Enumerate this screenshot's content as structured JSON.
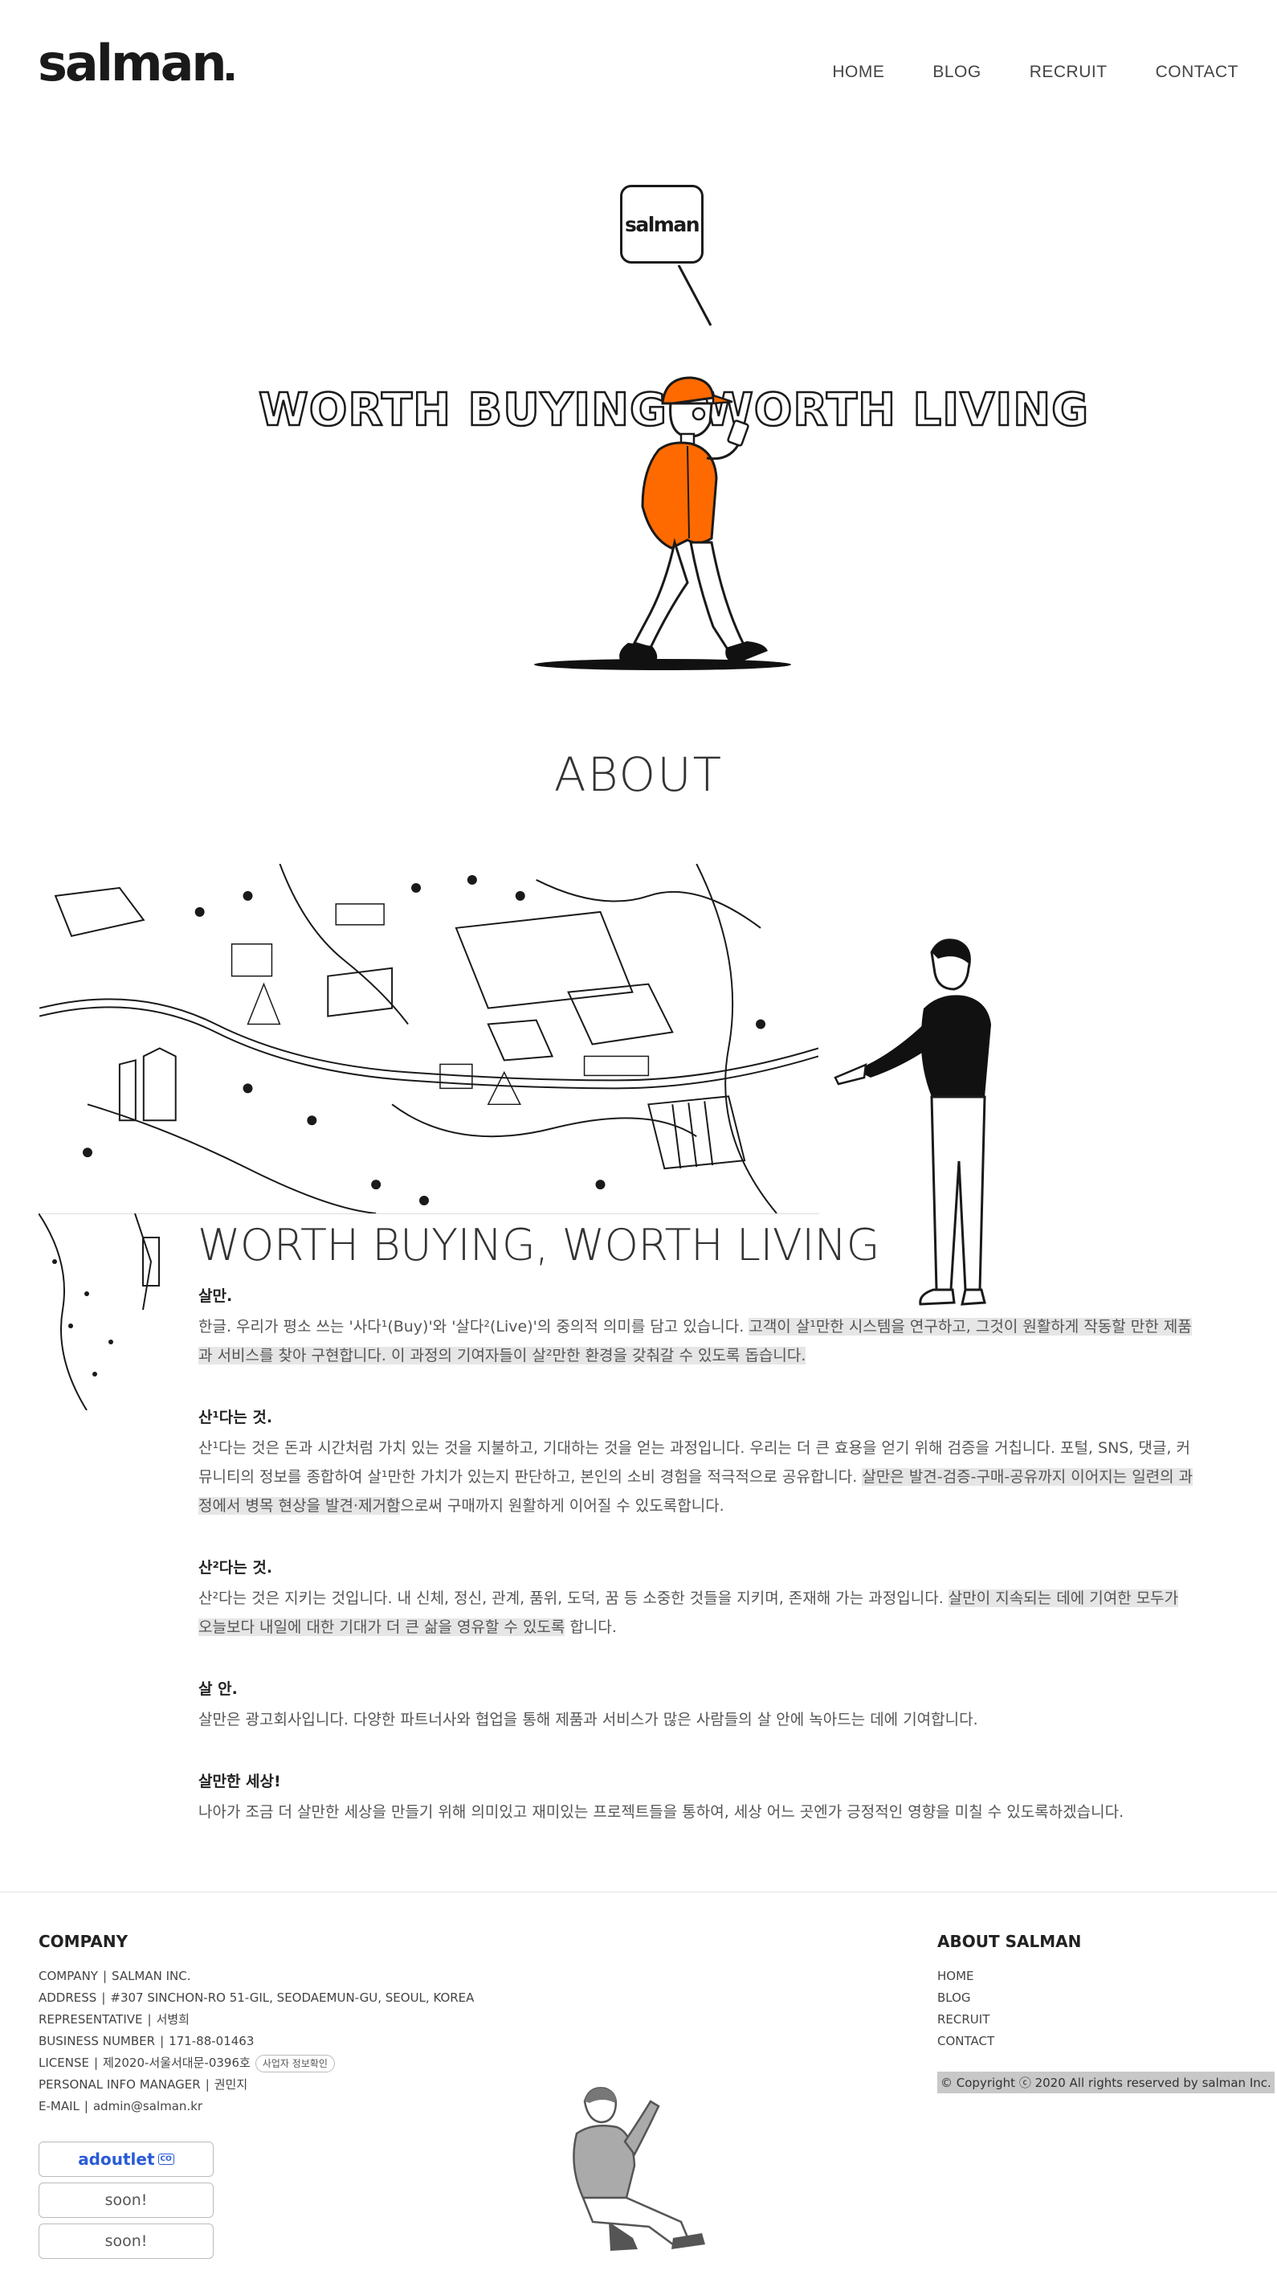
{
  "header": {
    "logo": "salman",
    "nav": [
      "HOME",
      "BLOG",
      "RECRUIT",
      "CONTACT"
    ]
  },
  "hero": {
    "bubble_logo": "salman",
    "word_left": "WORTH BUYING",
    "word_right": "WORTH LIVING",
    "accent_color": "#ff6a00"
  },
  "about": {
    "title": "ABOUT",
    "headline": "WORTH BUYING, WORTH LIVING",
    "blocks": [
      {
        "heading": "살만.",
        "text_plain": "한글. 우리가 평소 쓰는 '사다¹(Buy)'와 '살다²(Live)'의 중의적 의미를 담고 있습니다. ",
        "text_highlight": "고객이 살¹만한 시스템을 연구하고, 그것이 원활하게 작동할 만한 제품과 서비스를 찾아 구현합니다. 이 과정의 기여자들이 살²만한 환경을 갖춰갈 수 있도록 돕습니다.",
        "text_after": ""
      },
      {
        "heading": "산¹다는 것.",
        "text_plain": "산¹다는 것은 돈과 시간처럼 가치 있는 것을 지불하고, 기대하는 것을 얻는 과정입니다. 우리는 더 큰 효용을 얻기 위해 검증을 거칩니다. 포털, SNS, 댓글, 커뮤니티의 정보를 종합하여 살¹만한 가치가 있는지 판단하고, 본인의 소비 경험을 적극적으로 공유합니다. ",
        "text_highlight": "살만은 발견-검증-구매-공유까지 이어지는 일련의 과정에서 병목 현상을 발견·제거함",
        "text_after": "으로써 구매까지 원활하게 이어질 수 있도록합니다."
      },
      {
        "heading": "산²다는 것.",
        "text_plain": "산²다는 것은 지키는 것입니다. 내 신체, 정신, 관계, 품위, 도덕, 꿈 등 소중한 것들을 지키며, 존재해 가는 과정입니다. ",
        "text_highlight": "살만이 지속되는 데에 기여한 모두가 오늘보다 내일에 대한 기대가 더 큰 삶을 영유할 수 있도록",
        "text_after": " 합니다."
      },
      {
        "heading": "살 안.",
        "text_plain": "살만은 광고회사입니다. 다양한 파트너사와 협업을 통해 제품과 서비스가 많은 사람들의 살 안에 녹아드는 데에 기여합니다.",
        "text_highlight": "",
        "text_after": ""
      },
      {
        "heading": "살만한 세상!",
        "text_plain": "나아가 조금 더 살만한 세상을 만들기 위해 의미있고 재미있는 프로젝트들을 통하여, 세상 어느 곳엔가 긍정적인 영향을 미칠 수 있도록하겠습니다.",
        "text_highlight": "",
        "text_after": ""
      }
    ]
  },
  "footer": {
    "company_title": "COMPANY",
    "company_lines": [
      {
        "label": "COMPANY",
        "value": "SALMAN INC."
      },
      {
        "label": "ADDRESS",
        "value": "#307 SINCHON-RO 51-GIL, SEODAEMUN-GU, SEOUL, KOREA"
      },
      {
        "label": "REPRESENTATIVE",
        "value": "서병희"
      },
      {
        "label": "BUSINESS NUMBER",
        "value": "171-88-01463"
      },
      {
        "label": "LICENSE",
        "value": "제2020-서울서대문-0396호"
      },
      {
        "label": "PERSONAL INFO MANAGER",
        "value": "권민지"
      },
      {
        "label": "E-MAIL",
        "value": "admin@salman.kr"
      }
    ],
    "license_chip": "사업자 정보확인",
    "buttons": [
      {
        "label": "adoutlet",
        "badge": "CO"
      },
      {
        "label": "soon!"
      },
      {
        "label": "soon!"
      }
    ],
    "about_title": "ABOUT SALMAN",
    "about_links": [
      "HOME",
      "BLOG",
      "RECRUIT",
      "CONTACT"
    ],
    "copyright": "© Copyright ⓒ 2020 All rights reserved by salman Inc."
  }
}
